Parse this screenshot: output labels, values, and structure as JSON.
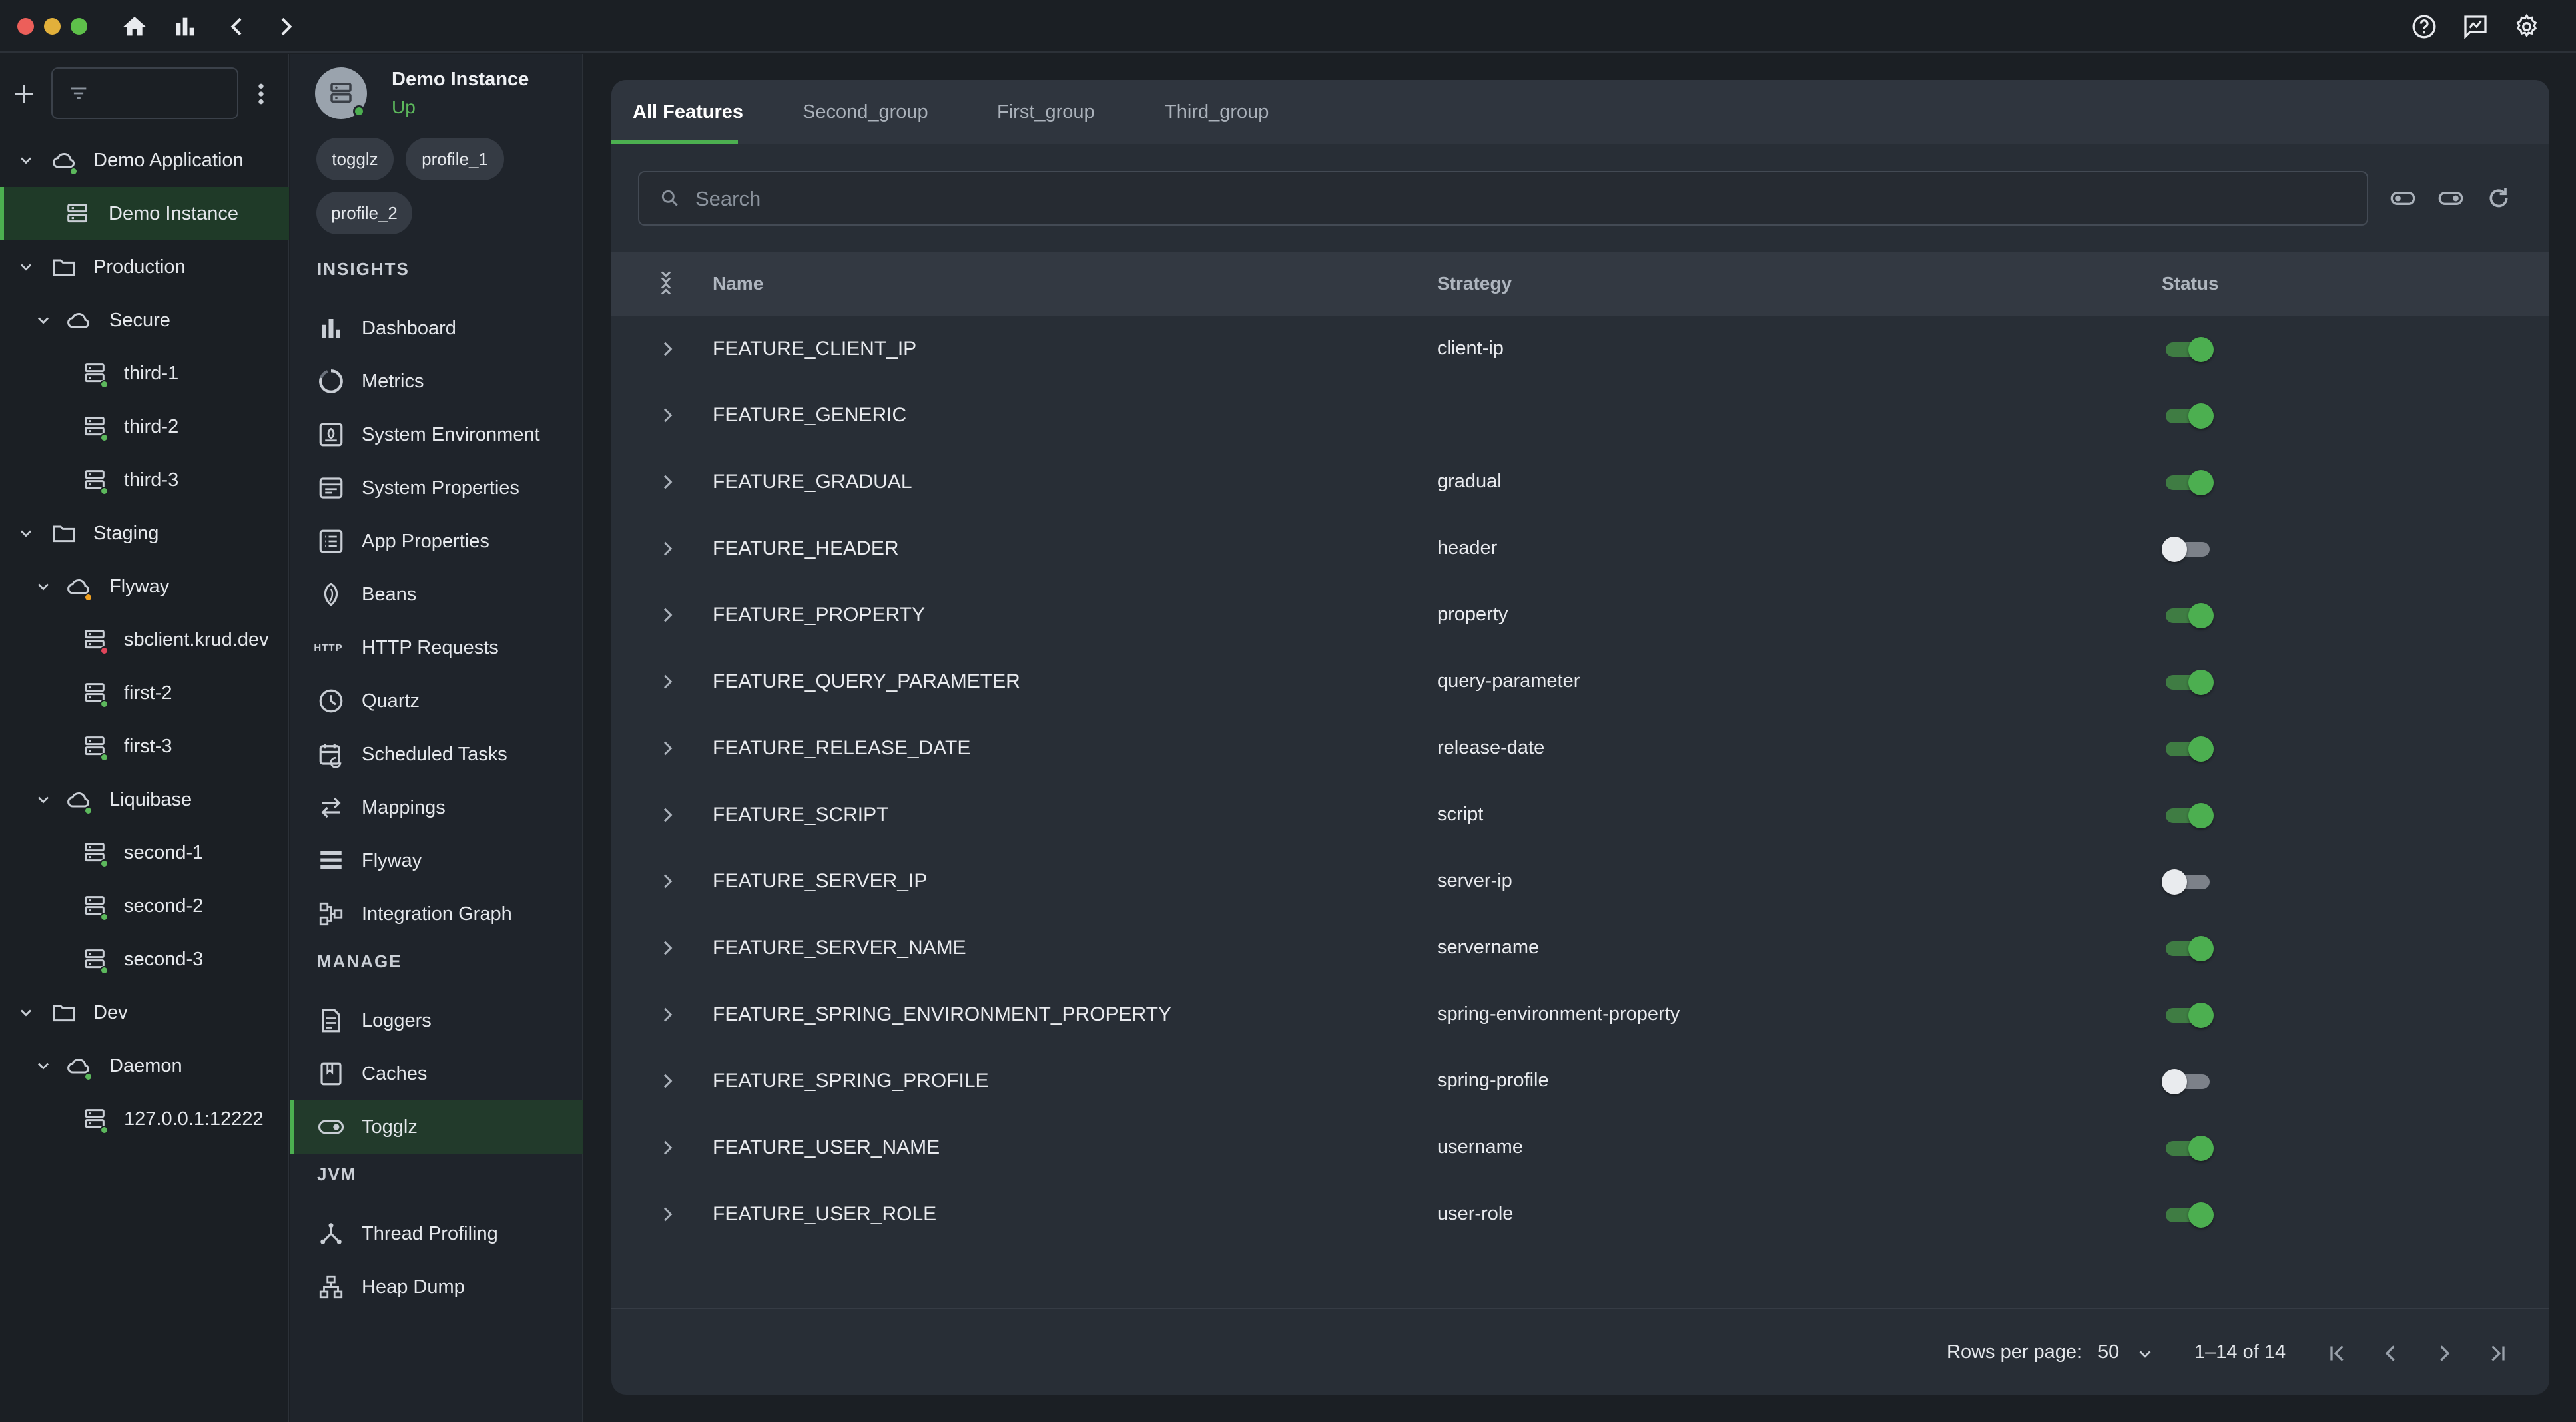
{
  "colors": {
    "accent": "#4caf50",
    "status_up": "#5cb85c",
    "status_warning": "#f0a020",
    "status_down": "#e0455a"
  },
  "titlebar": {
    "icons": [
      "home-icon",
      "bar-chart-icon",
      "back-icon",
      "forward-icon",
      "help-icon",
      "feedback-icon",
      "settings-icon"
    ]
  },
  "tree": {
    "filter_placeholder": "",
    "nodes": [
      {
        "label": "Demo Application",
        "type": "application",
        "status": "up",
        "expanded": true
      },
      {
        "label": "Demo Instance",
        "type": "instance",
        "selected": true
      },
      {
        "label": "Production",
        "type": "group",
        "expanded": true
      },
      {
        "label": "Secure",
        "type": "application",
        "expanded": true
      },
      {
        "label": "third-1",
        "type": "instance",
        "status": "up"
      },
      {
        "label": "third-2",
        "type": "instance",
        "status": "up"
      },
      {
        "label": "third-3",
        "type": "instance",
        "status": "up"
      },
      {
        "label": "Staging",
        "type": "group",
        "expanded": true
      },
      {
        "label": "Flyway",
        "type": "application",
        "status": "warning",
        "expanded": true
      },
      {
        "label": "sbclient.krud.dev",
        "type": "instance",
        "status": "down"
      },
      {
        "label": "first-2",
        "type": "instance",
        "status": "up"
      },
      {
        "label": "first-3",
        "type": "instance",
        "status": "up"
      },
      {
        "label": "Liquibase",
        "type": "application",
        "status": "up",
        "expanded": true
      },
      {
        "label": "second-1",
        "type": "instance",
        "status": "up"
      },
      {
        "label": "second-2",
        "type": "instance",
        "status": "up"
      },
      {
        "label": "second-3",
        "type": "instance",
        "status": "up"
      },
      {
        "label": "Dev",
        "type": "group",
        "expanded": true
      },
      {
        "label": "Daemon",
        "type": "application",
        "status": "up",
        "expanded": true
      },
      {
        "label": "127.0.0.1:12222",
        "type": "instance",
        "status": "up"
      }
    ]
  },
  "instance": {
    "name": "Demo Instance",
    "status": "Up",
    "chips": [
      "togglz",
      "profile_1",
      "profile_2"
    ]
  },
  "nav": {
    "sections": [
      {
        "title": "INSIGHTS",
        "items": [
          {
            "label": "Dashboard",
            "icon": "dashboard-icon"
          },
          {
            "label": "Metrics",
            "icon": "metrics-icon"
          },
          {
            "label": "System Environment",
            "icon": "system-environment-icon"
          },
          {
            "label": "System Properties",
            "icon": "system-properties-icon"
          },
          {
            "label": "App Properties",
            "icon": "app-properties-icon"
          },
          {
            "label": "Beans",
            "icon": "beans-icon"
          },
          {
            "label": "HTTP Requests",
            "icon": "http-icon"
          },
          {
            "label": "Quartz",
            "icon": "clock-icon"
          },
          {
            "label": "Scheduled Tasks",
            "icon": "calendar-icon"
          },
          {
            "label": "Mappings",
            "icon": "mappings-icon"
          },
          {
            "label": "Flyway",
            "icon": "flyway-icon"
          },
          {
            "label": "Integration Graph",
            "icon": "graph-icon"
          }
        ]
      },
      {
        "title": "MANAGE",
        "items": [
          {
            "label": "Loggers",
            "icon": "loggers-icon"
          },
          {
            "label": "Caches",
            "icon": "caches-icon"
          },
          {
            "label": "Togglz",
            "icon": "toggle-icon",
            "active": true
          }
        ]
      },
      {
        "title": "JVM",
        "items": [
          {
            "label": "Thread Profiling",
            "icon": "thread-profiling-icon"
          },
          {
            "label": "Heap Dump",
            "icon": "heap-dump-icon"
          }
        ]
      }
    ],
    "http_badge": "HTTP"
  },
  "main": {
    "tabs": [
      {
        "label": "All Features",
        "active": true
      },
      {
        "label": "Second_group"
      },
      {
        "label": "First_group"
      },
      {
        "label": "Third_group"
      }
    ],
    "search": {
      "placeholder": "Search"
    },
    "columns": {
      "name": "Name",
      "strategy": "Strategy",
      "status": "Status"
    },
    "rows": [
      {
        "name": "FEATURE_CLIENT_IP",
        "strategy": "client-ip",
        "enabled": true
      },
      {
        "name": "FEATURE_GENERIC",
        "strategy": "",
        "enabled": true
      },
      {
        "name": "FEATURE_GRADUAL",
        "strategy": "gradual",
        "enabled": true
      },
      {
        "name": "FEATURE_HEADER",
        "strategy": "header",
        "enabled": false
      },
      {
        "name": "FEATURE_PROPERTY",
        "strategy": "property",
        "enabled": true
      },
      {
        "name": "FEATURE_QUERY_PARAMETER",
        "strategy": "query-parameter",
        "enabled": true
      },
      {
        "name": "FEATURE_RELEASE_DATE",
        "strategy": "release-date",
        "enabled": true
      },
      {
        "name": "FEATURE_SCRIPT",
        "strategy": "script",
        "enabled": true
      },
      {
        "name": "FEATURE_SERVER_IP",
        "strategy": "server-ip",
        "enabled": false
      },
      {
        "name": "FEATURE_SERVER_NAME",
        "strategy": "servername",
        "enabled": true
      },
      {
        "name": "FEATURE_SPRING_ENVIRONMENT_PROPERTY",
        "strategy": "spring-environment-property",
        "enabled": true
      },
      {
        "name": "FEATURE_SPRING_PROFILE",
        "strategy": "spring-profile",
        "enabled": false
      },
      {
        "name": "FEATURE_USER_NAME",
        "strategy": "username",
        "enabled": true
      },
      {
        "name": "FEATURE_USER_ROLE",
        "strategy": "user-role",
        "enabled": true
      }
    ],
    "pagination": {
      "rows_per_page_label": "Rows per page:",
      "rows_per_page": "50",
      "range": "1–14 of 14"
    }
  }
}
